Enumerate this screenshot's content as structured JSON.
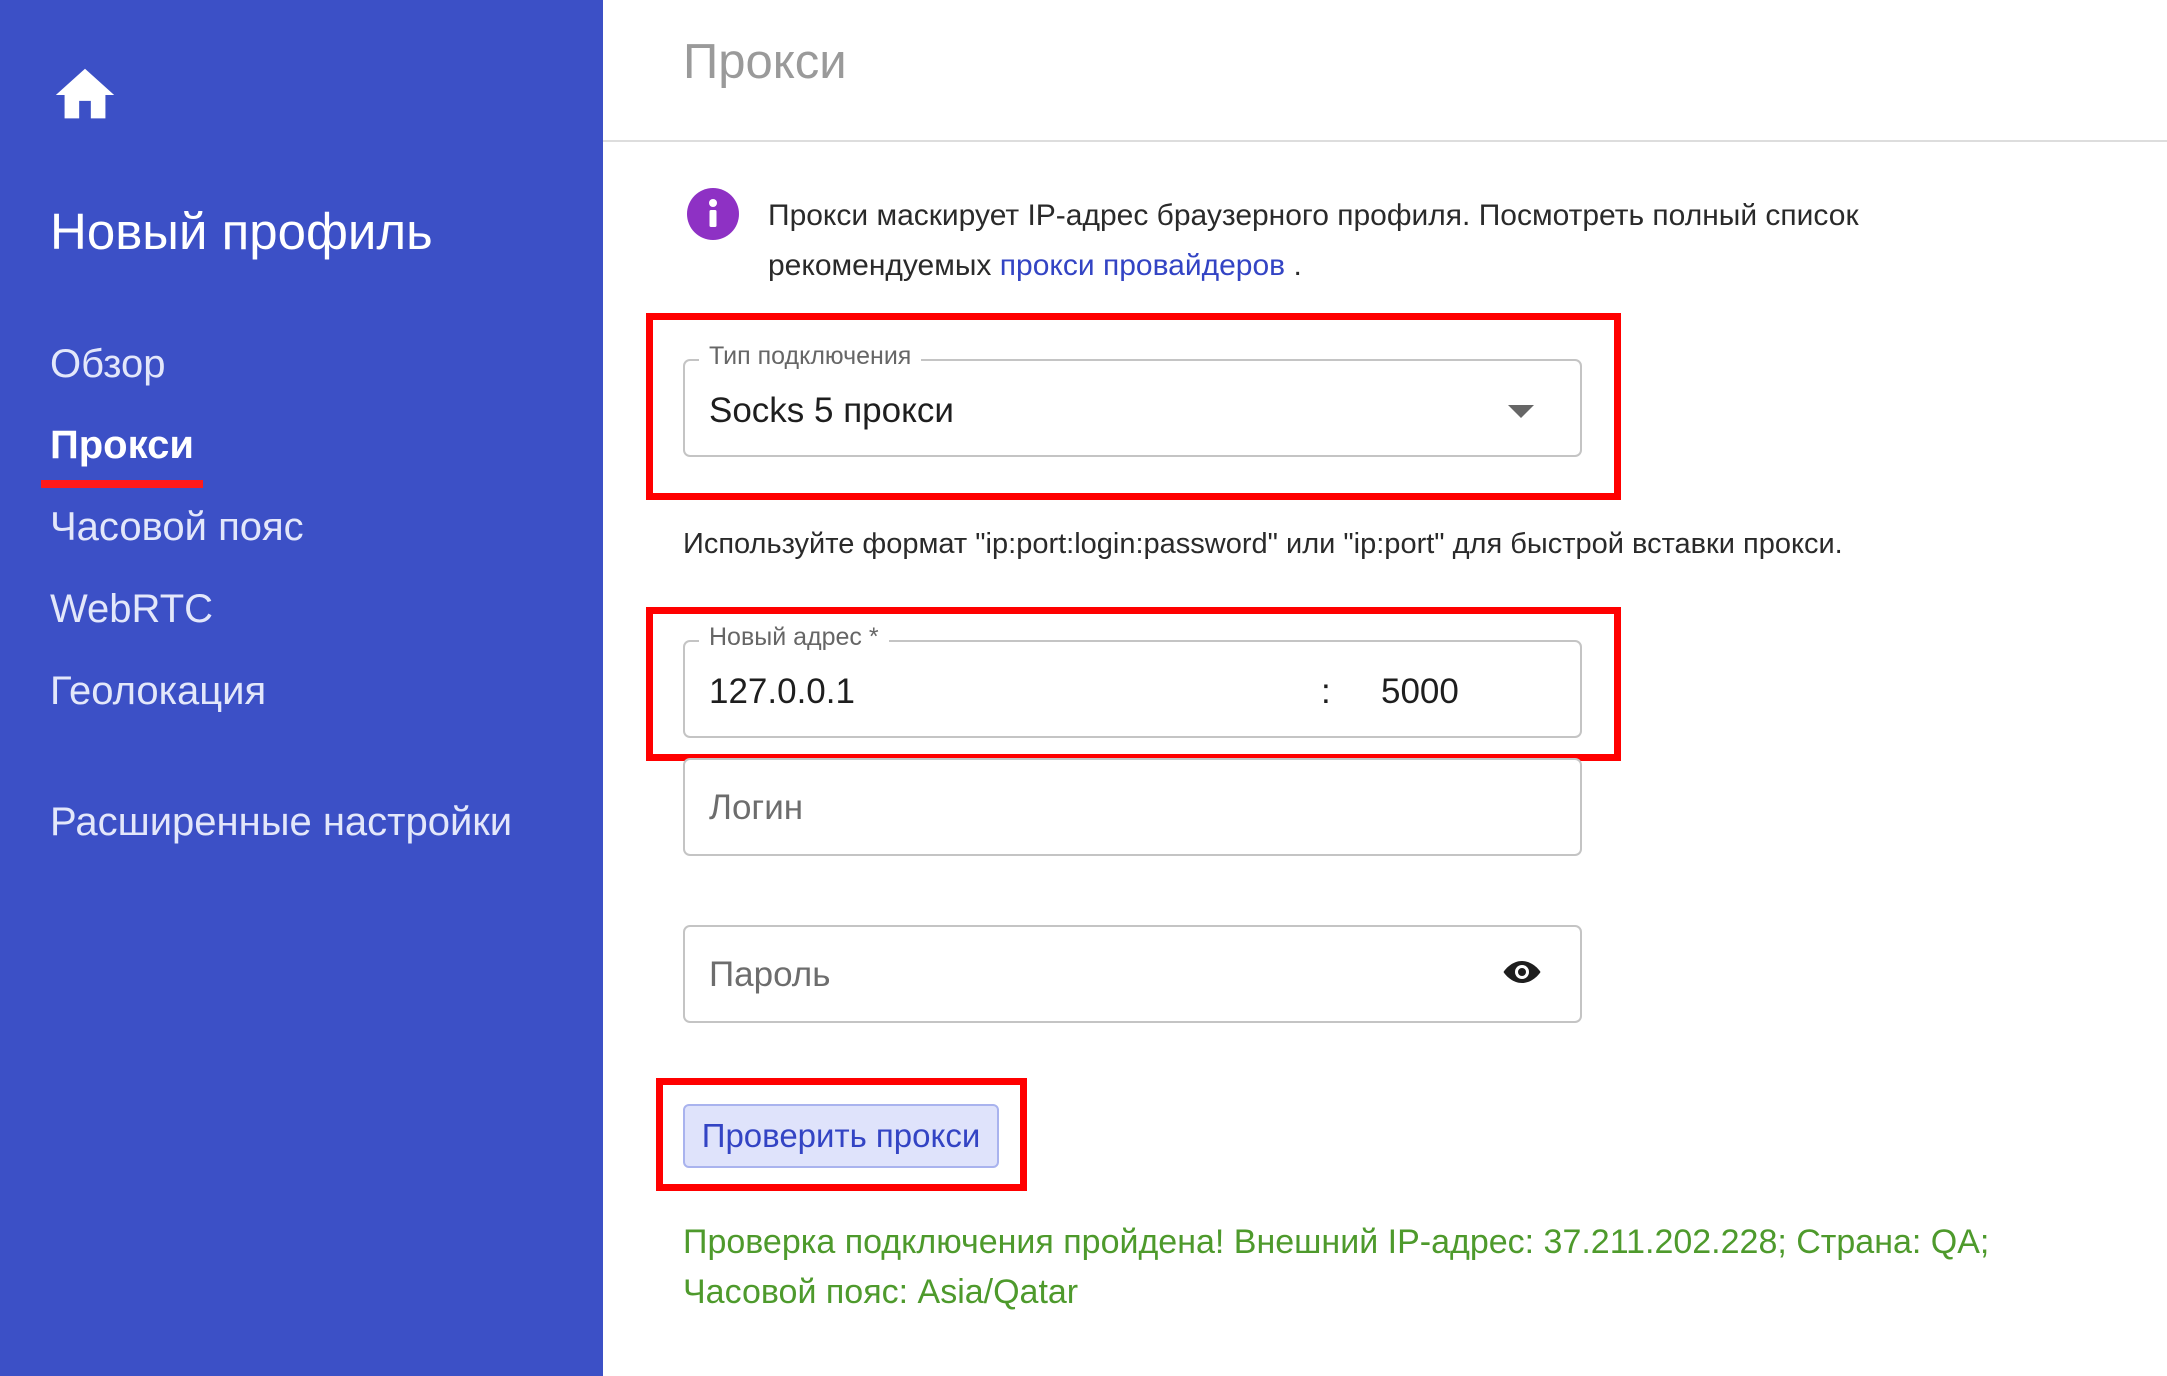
{
  "sidebar": {
    "profile_title": "Новый профиль",
    "nav": {
      "overview": "Обзор",
      "proxy": "Прокси",
      "timezone": "Часовой пояс",
      "webrtc": "WebRTC",
      "geolocation": "Геолокация",
      "advanced": "Расширенные настройки"
    },
    "active_item": "Прокси"
  },
  "main": {
    "title": "Прокси",
    "info": {
      "text": "Прокси маскирует IP-адрес браузерного профиля. Посмотреть полный список рекомендуемых ",
      "link": "прокси провайдеров",
      "suffix": " ."
    },
    "connection_type": {
      "label": "Тип подключения",
      "value": "Socks 5 прокси"
    },
    "hint": "Используйте формат \"ip:port:login:password\" или \"ip:port\" для быстрой вставки прокси.",
    "address": {
      "label": "Новый адрес *",
      "host": "127.0.0.1",
      "separator": ":",
      "port": "5000"
    },
    "login": {
      "placeholder": "Логин"
    },
    "password": {
      "placeholder": "Пароль"
    },
    "check_button": "Проверить прокси",
    "status": "Проверка подключения пройдена! Внешний IP-адрес: 37.211.202.228; Страна: QA; Часовой пояс: Asia/Qatar"
  },
  "colors": {
    "sidebar_bg": "#3c50c6",
    "accent": "#3344c4",
    "info_icon": "#8e31c4",
    "success": "#4e9a2c",
    "highlight": "#ff0000"
  },
  "icons": {
    "home": "home-icon",
    "info": "info-icon",
    "dropdown": "dropdown-arrow-icon",
    "visibility": "eye-icon"
  }
}
